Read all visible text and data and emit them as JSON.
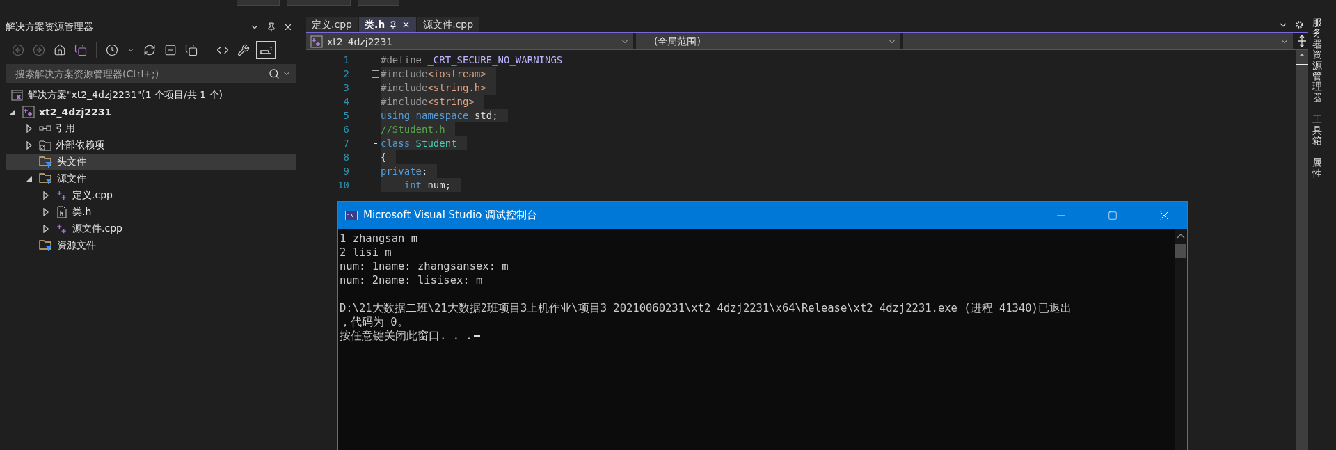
{
  "solution_explorer": {
    "title": "解决方案资源管理器",
    "preview_toggle": {
      "on": true
    },
    "search": {
      "placeholder": "搜索解决方案资源管理器(Ctrl+;)"
    },
    "tree": [
      {
        "kind": "solution",
        "label": "解决方案\"xt2_4dzj2231\"(1 个项目/共 1 个)",
        "selected": false,
        "children": [
          {
            "kind": "project",
            "label": "xt2_4dzj2231",
            "selected": false,
            "expanded": true,
            "children": [
              {
                "kind": "references",
                "label": "引用",
                "selected": false,
                "expanded": false
              },
              {
                "kind": "external",
                "label": "外部依赖项",
                "selected": false,
                "expanded": false
              },
              {
                "kind": "filter",
                "label": "头文件",
                "selected": true
              },
              {
                "kind": "filter",
                "label": "源文件",
                "selected": false,
                "expanded": true,
                "children": [
                  {
                    "kind": "cpp",
                    "label": "定义.cpp",
                    "selected": false,
                    "expanded": false
                  },
                  {
                    "kind": "header",
                    "label": "类.h",
                    "selected": false,
                    "expanded": false
                  },
                  {
                    "kind": "cpp",
                    "label": "源文件.cpp",
                    "selected": false,
                    "expanded": false
                  }
                ]
              },
              {
                "kind": "filter",
                "label": "资源文件",
                "selected": false
              }
            ]
          }
        ]
      }
    ]
  },
  "editor": {
    "tabs": [
      {
        "label": "定义.cpp",
        "selected": false
      },
      {
        "label": "类.h",
        "selected": true
      },
      {
        "label": "源文件.cpp",
        "selected": false
      }
    ],
    "nav": {
      "project": "xt2_4dzj2231",
      "scope": "(全局范围)"
    },
    "lines": [
      {
        "number": "1",
        "highlighted": false,
        "tokens": [
          {
            "kind": "preproc",
            "text": "#define "
          },
          {
            "kind": "macro",
            "text": "_CRT_SECURE_NO_WARNINGS"
          }
        ]
      },
      {
        "number": "2",
        "fold": true,
        "highlighted": true,
        "tokens": [
          {
            "kind": "preproc",
            "text": "#include"
          },
          {
            "kind": "string",
            "text": "<iostream>"
          }
        ]
      },
      {
        "number": "3",
        "highlighted": true,
        "tokens": [
          {
            "kind": "preproc",
            "text": "#include"
          },
          {
            "kind": "string",
            "text": "<string.h>"
          }
        ]
      },
      {
        "number": "4",
        "highlighted": true,
        "tokens": [
          {
            "kind": "preproc",
            "text": "#include"
          },
          {
            "kind": "string",
            "text": "<string>"
          }
        ]
      },
      {
        "number": "5",
        "highlighted": true,
        "tokens": [
          {
            "kind": "keyword",
            "text": "using"
          },
          {
            "kind": "keyword",
            "text": " namespace"
          },
          {
            "kind": "plain",
            "text": " std;"
          }
        ]
      },
      {
        "number": "6",
        "highlighted": true,
        "tokens": [
          {
            "kind": "comment",
            "text": "//Student.h"
          }
        ]
      },
      {
        "number": "7",
        "fold": true,
        "highlighted": true,
        "tokens": [
          {
            "kind": "keyword",
            "text": "class"
          },
          {
            "kind": "type",
            "text": " Student"
          }
        ]
      },
      {
        "number": "8",
        "highlighted": true,
        "tokens": [
          {
            "kind": "plain",
            "text": "{"
          }
        ]
      },
      {
        "number": "9",
        "highlighted": true,
        "tokens": [
          {
            "kind": "keyword",
            "text": "private"
          },
          {
            "kind": "plain",
            "text": ":"
          }
        ]
      },
      {
        "number": "10",
        "highlighted": true,
        "tokens": [
          {
            "kind": "keyword",
            "text": "    int"
          },
          {
            "kind": "plain",
            "text": " num;"
          }
        ]
      }
    ]
  },
  "side_tabs": [
    "服务器资源管理器",
    "工具箱",
    "属性"
  ],
  "console": {
    "title": "Microsoft Visual Studio 调试控制台",
    "blocks": [
      [
        "1 zhangsan m",
        "2 lisi m",
        "num: 1name: zhangsansex: m",
        "num: 2name: lisisex: m"
      ],
      [
        "D:\\21大数据二班\\21大数据2班项目3上机作业\\项目3_20210060231\\xt2_4dzj2231\\x64\\Release\\xt2_4dzj2231.exe (进程 41340)已退出",
        "，代码为 0。",
        "按任意键关闭此窗口. . ."
      ]
    ]
  }
}
